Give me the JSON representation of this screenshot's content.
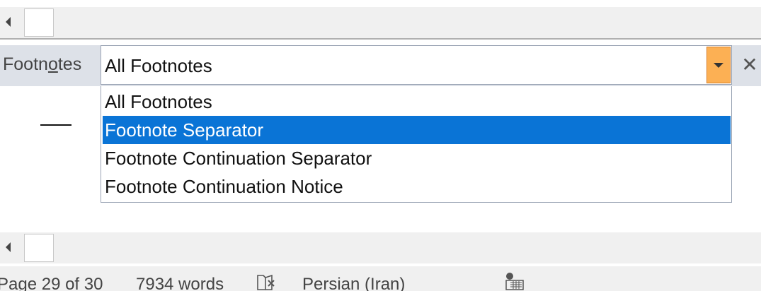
{
  "notes_bar": {
    "label_prefix": "Footn",
    "label_underlined": "o",
    "label_suffix": "tes",
    "combo_value": "All Footnotes",
    "close_glyph": "✕"
  },
  "dropdown": {
    "options": [
      "All Footnotes",
      "Footnote Separator",
      "Footnote Continuation Separator",
      "Footnote Continuation Notice"
    ],
    "selected_index": 1
  },
  "status_bar": {
    "page": "Page 29 of 30",
    "words": "7934 words",
    "language": "Persian (Iran)"
  },
  "icons": {
    "scroll_left": "scroll-left-arrow-icon",
    "dropdown": "dropdown-arrow-icon",
    "close": "close-icon",
    "proofing": "proofing-errors-icon",
    "macro": "macro-recording-icon"
  },
  "colors": {
    "selection": "#0a74d6",
    "dropdown_button": "#fcb054",
    "notes_bar": "#dde1e8"
  }
}
